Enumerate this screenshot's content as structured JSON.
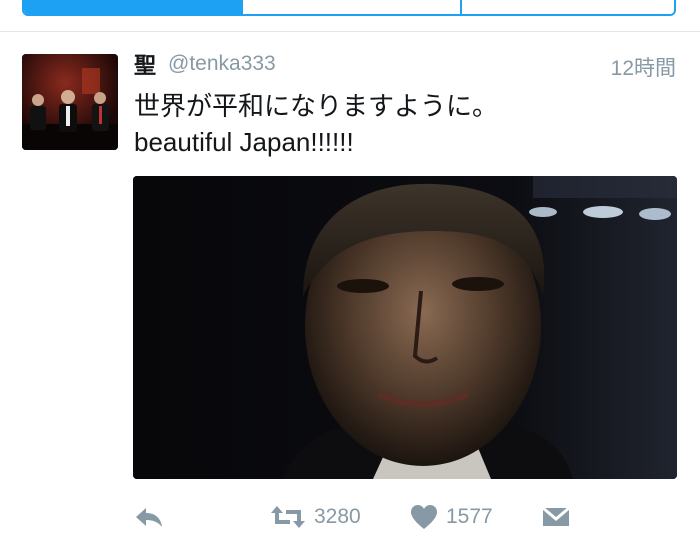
{
  "tweet": {
    "username": "聖",
    "handle": "@tenka333",
    "time": "12時間",
    "lines": [
      "世界が平和になりますように。",
      "beautiful Japan!!!!!!"
    ]
  },
  "stats": {
    "retweets": "3280",
    "likes": "1577"
  },
  "icons": [
    "reply-icon",
    "retweet-icon",
    "like-icon",
    "direct-message-icon"
  ],
  "colors": {
    "accent": "#1da1f2",
    "muted": "#8899a6",
    "text": "#14171a"
  }
}
